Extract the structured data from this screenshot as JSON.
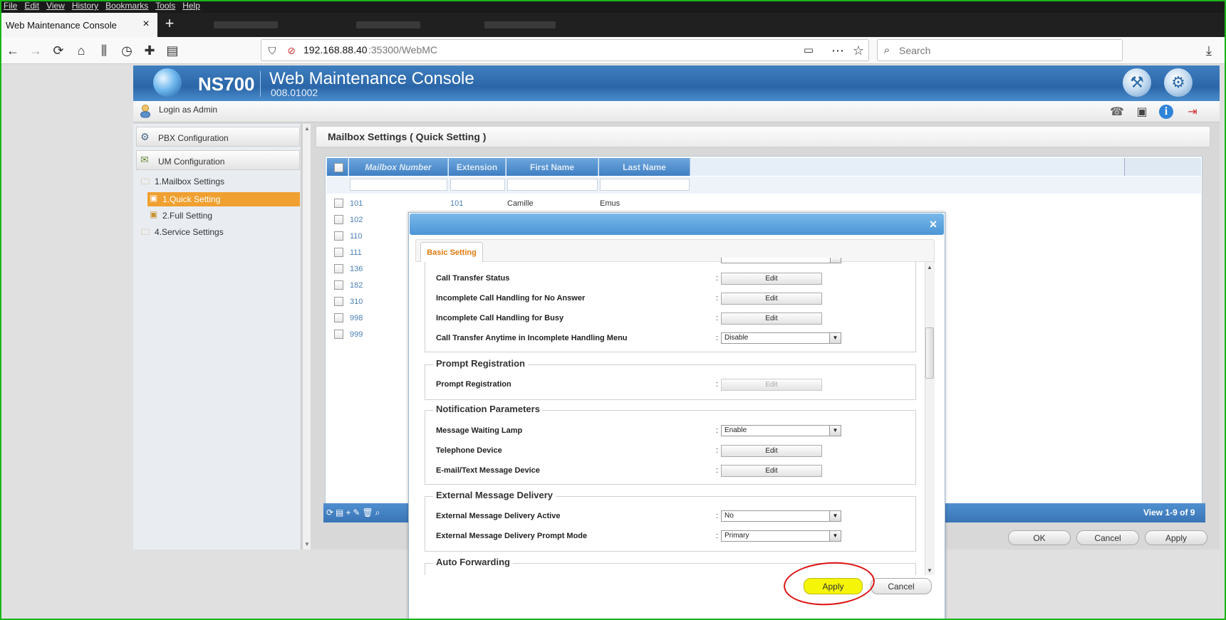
{
  "browser": {
    "menu": [
      "File",
      "Edit",
      "View",
      "History",
      "Bookmarks",
      "Tools",
      "Help"
    ],
    "tab_title": "Web Maintenance Console",
    "tab_close": "×",
    "new_tab": "+",
    "url_host": "192.168.88.40",
    "url_rest": ":35300/WebMC",
    "search_placeholder": "Search"
  },
  "app": {
    "model": "NS700",
    "title": "Web Maintenance Console",
    "version": "008.01002",
    "login": "Login as Admin"
  },
  "sidebar": {
    "pbx": "PBX Configuration",
    "um": "UM Configuration",
    "mailbox_settings": "1.Mailbox Settings",
    "quick_setting": "1.Quick Setting",
    "full_setting": "2.Full Setting",
    "service_settings": "4.Service Settings"
  },
  "main": {
    "title": "Mailbox Settings ( Quick Setting )",
    "columns": [
      "Mailbox Number",
      "Extension",
      "First Name",
      "Last Name"
    ],
    "rows": [
      {
        "mailbox": "101",
        "extension": "101",
        "first": "Camille",
        "last": "Emus"
      },
      {
        "mailbox": "102"
      },
      {
        "mailbox": "110"
      },
      {
        "mailbox": "111"
      },
      {
        "mailbox": "136"
      },
      {
        "mailbox": "182"
      },
      {
        "mailbox": "310"
      },
      {
        "mailbox": "998"
      },
      {
        "mailbox": "999"
      }
    ],
    "view_count": "View 1-9 of 9",
    "ok": "OK",
    "cancel": "Cancel",
    "apply": "Apply"
  },
  "dialog": {
    "close": "×",
    "tab": "Basic Setting",
    "colon": ":",
    "edit": "Edit",
    "call_transfer_status": "Call Transfer Status",
    "incomplete_no_answer": "Incomplete Call Handling for No Answer",
    "incomplete_busy": "Incomplete Call Handling for Busy",
    "transfer_anytime": "Call Transfer Anytime in Incomplete Handling Menu",
    "transfer_anytime_value": "Disable",
    "prompt_registration_section": "Prompt Registration",
    "prompt_registration": "Prompt Registration",
    "notification_section": "Notification Parameters",
    "mwl": "Message Waiting Lamp",
    "mwl_value": "Enable",
    "telephone_device": "Telephone Device",
    "email_device": "E-mail/Text Message Device",
    "external_section": "External Message Delivery",
    "external_active": "External Message Delivery Active",
    "external_active_value": "No",
    "external_prompt_mode": "External Message Delivery Prompt Mode",
    "external_prompt_mode_value": "Primary",
    "auto_forwarding_section": "Auto Forwarding",
    "apply": "Apply",
    "cancel": "Cancel"
  },
  "colors": {
    "highlight_yellow": "#f5f507",
    "annotation_red": "#d11111",
    "header_blue": "#2b66a8",
    "selected_orange": "#f0a030"
  }
}
